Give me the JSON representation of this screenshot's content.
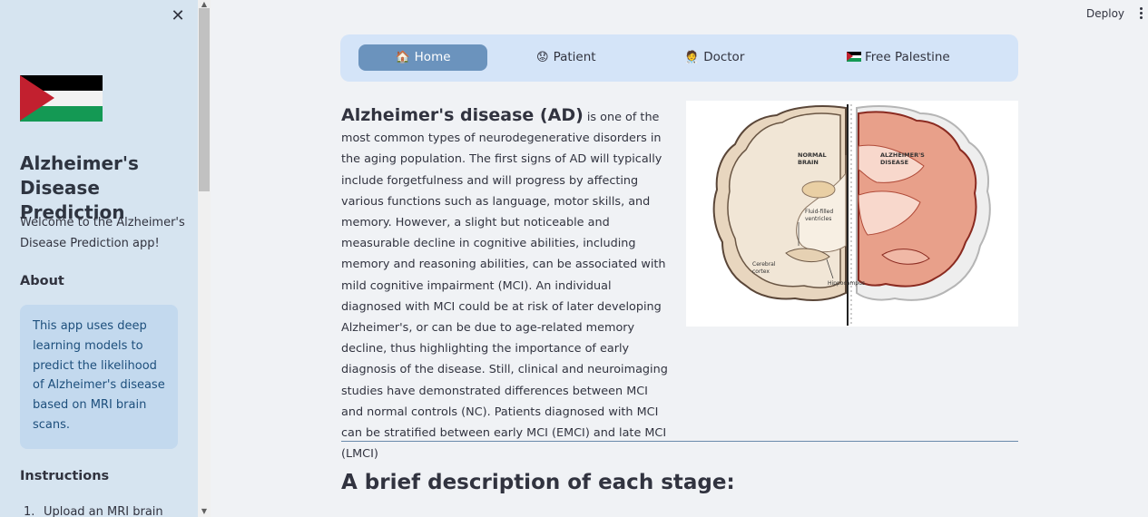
{
  "topbar": {
    "deploy_label": "Deploy"
  },
  "sidebar": {
    "title": "Alzheimer's Disease Prediction",
    "welcome": "Welcome to the Alzheimer's Disease Prediction app!",
    "about_heading": "About",
    "about_text": "This app uses deep learning models to predict the likelihood of Alzheimer's disease based on MRI brain scans.",
    "instructions_heading": "Instructions",
    "instructions": [
      {
        "num": "1.",
        "text": "Upload an MRI brain"
      }
    ]
  },
  "nav": {
    "items": [
      {
        "label": "Home",
        "icon": "house-icon"
      },
      {
        "label": "Patient",
        "icon": "worried-face-icon"
      },
      {
        "label": "Doctor",
        "icon": "doctor-icon"
      },
      {
        "label": "Free Palestine",
        "icon": "palestine-flag-icon"
      }
    ],
    "active_index": 0
  },
  "main": {
    "lead_term": "Alzheimer's disease (AD)",
    "body_text": " is one of the most common types of neurodegenerative disorders in the aging population. The first signs of AD will typically include forgetfulness and will progress by affecting various functions such as language, motor skills, and memory. However, a slight but noticeable and measurable decline in cognitive abilities, including memory and reasoning abilities, can be associated with mild cognitive impairment (MCI). An individual diagnosed with MCI could be at risk of later developing Alzheimer's, or can be due to age-related memory decline, thus highlighting the importance of early diagnosis of the disease. Still, clinical and neuroimaging studies have demonstrated differences between MCI and normal controls (NC). Patients diagnosed with MCI can be stratified between early MCI (EMCI) and late MCI (LMCI)",
    "image_labels": {
      "normal": [
        "NORMAL",
        "BRAIN"
      ],
      "alz": [
        "ALZHEIMER'S",
        "DISEASE"
      ],
      "ventricles": [
        "Fluid-filled",
        "ventricles"
      ],
      "cortex": [
        "Cerebral",
        "cortex"
      ],
      "hippocampus": "Hippocampus"
    },
    "section_heading": "A brief description of each stage:"
  },
  "colors": {
    "sidebar_bg": "#d6e4f0",
    "nav_bg": "#d4e4f8",
    "nav_active": "#6b93bd",
    "info_bg": "#c3d9ee",
    "info_text": "#1d4f7c",
    "flag_black": "#000000",
    "flag_white": "#ffffff",
    "flag_green": "#149954",
    "flag_red": "#c2202f"
  }
}
